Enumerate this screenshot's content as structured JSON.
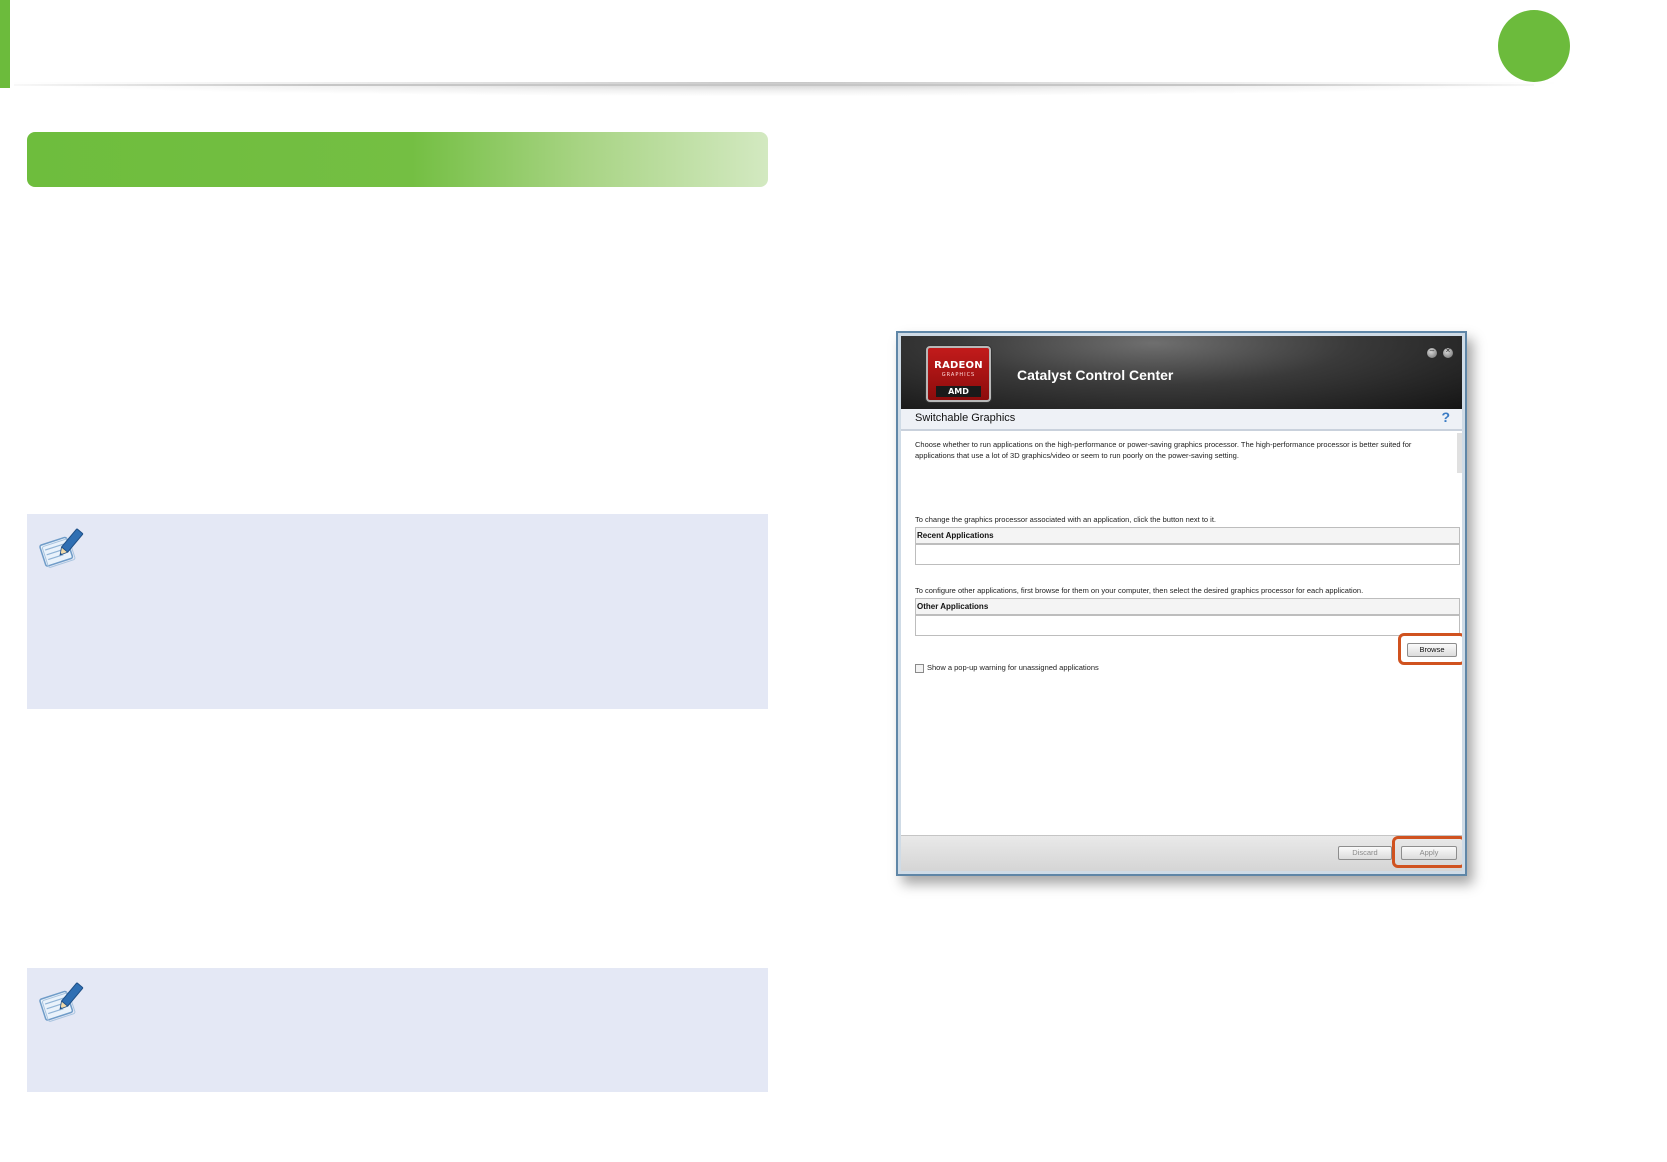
{
  "header": {},
  "catalyst_window": {
    "logo": {
      "brand": "RADEON",
      "sub": "GRAPHICS",
      "maker": "AMD"
    },
    "title": "Catalyst Control Center",
    "window_buttons": [
      "minimize",
      "close"
    ],
    "page_title": "Switchable Graphics",
    "help_label": "?",
    "description": "Choose whether to run applications on the high-performance or power-saving graphics processor. The high-performance processor is better suited for applications that use a lot of 3D graphics/video or seem to run poorly on the power-saving setting.",
    "instruction_recent": "To change the graphics processor associated with an application, click the button next to it.",
    "recent_header": "Recent Applications",
    "instruction_other": "To configure other applications, first browse for them on your computer, then select the desired graphics processor for each application.",
    "other_header": "Other Applications",
    "browse_label": "Browse",
    "checkbox_label": "Show a pop-up warning for unassigned applications",
    "checkbox_checked": false,
    "discard_label": "Discard",
    "apply_label": "Apply"
  },
  "colors": {
    "accent_green": "#6cbb3c",
    "note_background": "#e4e8f5",
    "highlight_outline": "#d0521f"
  },
  "icons": {
    "note": "note-pencil-icon"
  }
}
